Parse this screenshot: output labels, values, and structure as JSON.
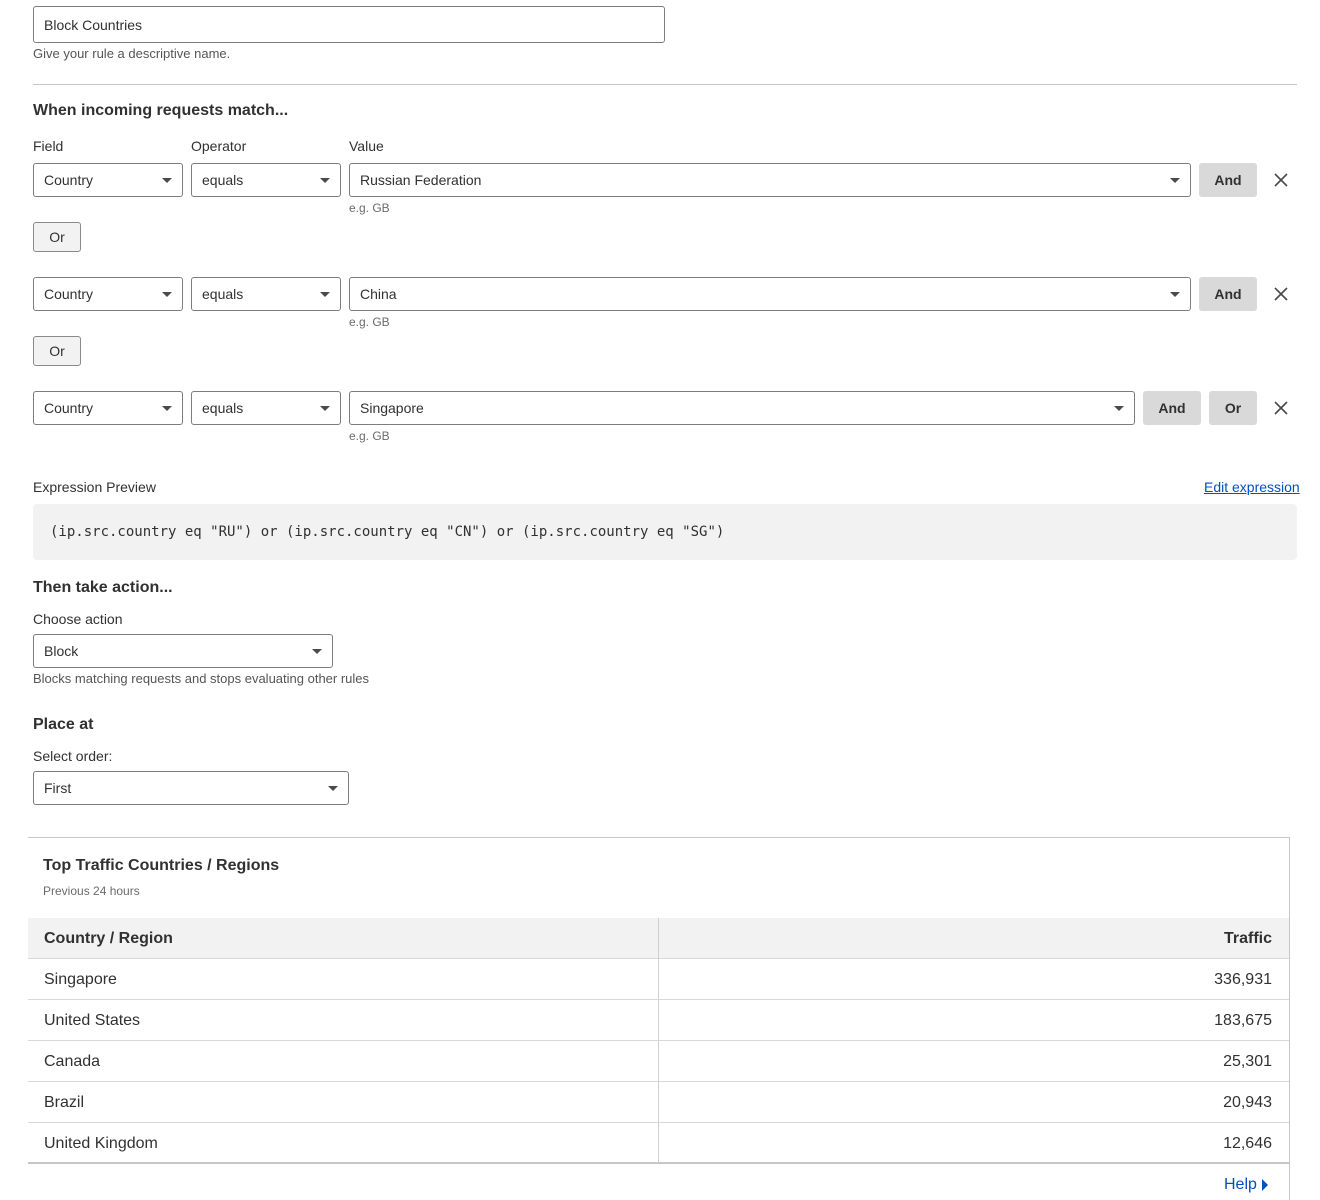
{
  "rule_name": {
    "value": "Block Countries",
    "hint": "Give your rule a descriptive name."
  },
  "match": {
    "heading": "When incoming requests match...",
    "field_label": "Field",
    "operator_label": "Operator",
    "value_label": "Value",
    "value_hint": "e.g. GB",
    "and_label": "And",
    "or_label": "Or",
    "rows": [
      {
        "field": "Country",
        "operator": "equals",
        "value": "Russian Federation"
      },
      {
        "field": "Country",
        "operator": "equals",
        "value": "China"
      },
      {
        "field": "Country",
        "operator": "equals",
        "value": "Singapore"
      }
    ]
  },
  "expression": {
    "label": "Expression Preview",
    "edit_link": "Edit expression",
    "text": "(ip.src.country eq \"RU\") or (ip.src.country eq \"CN\") or (ip.src.country eq \"SG\")"
  },
  "action": {
    "heading": "Then take action...",
    "label": "Choose action",
    "value": "Block",
    "hint": "Blocks matching requests and stops evaluating other rules"
  },
  "place": {
    "heading": "Place at",
    "label": "Select order:",
    "value": "First"
  },
  "traffic": {
    "title": "Top Traffic Countries / Regions",
    "subtitle": "Previous 24 hours",
    "col_country": "Country / Region",
    "col_traffic": "Traffic",
    "rows": [
      {
        "country": "Singapore",
        "traffic": "336,931"
      },
      {
        "country": "United States",
        "traffic": "183,675"
      },
      {
        "country": "Canada",
        "traffic": "25,301"
      },
      {
        "country": "Brazil",
        "traffic": "20,943"
      },
      {
        "country": "United Kingdom",
        "traffic": "12,646"
      }
    ],
    "help": "Help"
  },
  "icons": {
    "dropdown": "chevron-down-icon",
    "remove": "close-icon",
    "help": "caret-right-icon"
  },
  "colors": {
    "link": "#0051c3",
    "button_gray": "#d9d9d9",
    "panel_header": "#f2f2f2"
  }
}
